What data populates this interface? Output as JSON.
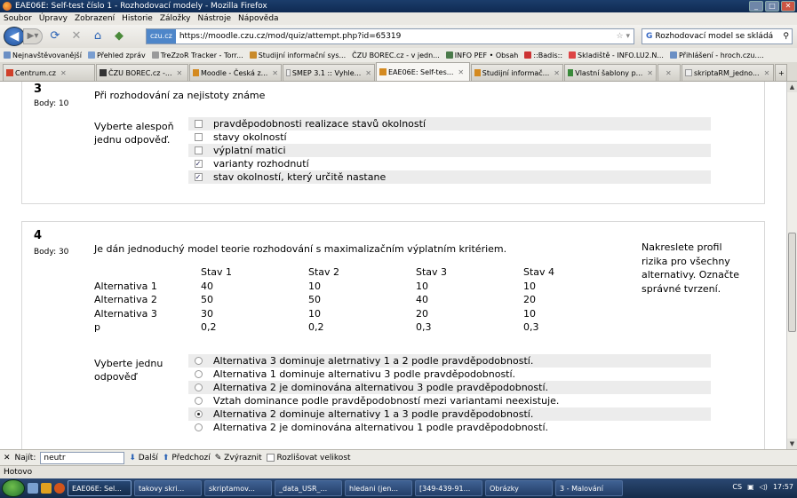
{
  "window": {
    "title": "EAE06E: Self-test číslo 1 - Rozhodovací modely - Mozilla Firefox"
  },
  "menu": [
    "Soubor",
    "Úpravy",
    "Zobrazení",
    "Historie",
    "Záložky",
    "Nástroje",
    "Nápověda"
  ],
  "nav": {
    "site_badge": "czu.cz",
    "url": "https://moodle.czu.cz/mod/quiz/attempt.php?id=65319",
    "search_value": "Rozhodovací model se skládá"
  },
  "bookmarks": [
    "Nejnavštěvovanější",
    "Přehled zpráv",
    "TreZzoR Tracker - Torr...",
    "Studijní informační sys...",
    "ČZU BOREC.cz - v jedn...",
    "INFO PEF • Obsah",
    "::Badis::",
    "Skladiště - INFO.LU2.N...",
    "Přihlášení - hroch.czu...."
  ],
  "tabs": [
    {
      "label": "Centrum.cz",
      "active": false
    },
    {
      "label": "ČZU BOREC.cz -...",
      "active": false
    },
    {
      "label": "Moodle - Česká z...",
      "active": false
    },
    {
      "label": "SMEP 3.1 :: Vyhle...",
      "active": false
    },
    {
      "label": "EAE06E: Self-tes...",
      "active": true
    },
    {
      "label": "Studijní informač...",
      "active": false
    },
    {
      "label": "Vlastní šablony p...",
      "active": false
    },
    {
      "label": "",
      "active": false
    },
    {
      "label": "skriptaRM_jedno...",
      "active": false
    }
  ],
  "q3": {
    "number": "3",
    "points": "Body: 10",
    "text": "Při rozhodování za nejistoty známe",
    "choose": "Vyberte alespoň jednu odpověď.",
    "options": [
      {
        "label": "pravděpodobnosti realizace stavů okolností",
        "checked": false
      },
      {
        "label": "stavy okolností",
        "checked": false
      },
      {
        "label": "výplatní matici",
        "checked": false
      },
      {
        "label": "varianty rozhodnutí",
        "checked": true
      },
      {
        "label": "stav okolností, který určitě nastane",
        "checked": true
      }
    ]
  },
  "q4": {
    "number": "4",
    "points": "Body: 30",
    "text": "Je dán jednoduchý model teorie rozhodování s maximalizačním výplatním kritériem.",
    "note": "Nakreslete profil rizika pro všechny alternativy. Označte správné tvrzení.",
    "table": {
      "headers": [
        "",
        "Stav 1",
        "Stav 2",
        "Stav 3",
        "Stav 4"
      ],
      "rows": [
        [
          "Alternativa 1",
          "40",
          "10",
          "10",
          "10"
        ],
        [
          "Alternativa 2",
          "50",
          "50",
          "40",
          "20"
        ],
        [
          "Alternativa 3",
          "30",
          "10",
          "20",
          "10"
        ],
        [
          "p",
          "0,2",
          "0,2",
          "0,3",
          "0,3"
        ]
      ]
    },
    "choose": "Vyberte jednu odpověď",
    "options": [
      {
        "label": "Alternativa 3 dominuje aletrnativy 1 a 2 podle pravděpodobností.",
        "selected": false
      },
      {
        "label": "Alternativa 1 dominuje alternativu 3 podle pravděpodobností.",
        "selected": false
      },
      {
        "label": "Alternativa 2 je dominována alternativou 3 podle pravděpodobností.",
        "selected": false
      },
      {
        "label": "Vztah dominance podle pravděpodobností mezi variantami neexistuje.",
        "selected": false
      },
      {
        "label": "Alternativa 2 dominuje alternativy 1 a 3 podle pravděpodobností.",
        "selected": true
      },
      {
        "label": "Alternativa 2 je dominována alternativou 1 podle pravděpodobností.",
        "selected": false
      }
    ]
  },
  "findbar": {
    "close": "✕",
    "label": "Najít:",
    "value": "neutr",
    "next": "Další",
    "prev": "Předchozí",
    "highlight": "Zvýraznit",
    "case": "Rozlišovat velikost"
  },
  "status": "Hotovo",
  "taskbar": {
    "tasks": [
      "EAE06E: Sel...",
      "takovy skri...",
      "skriptamov...",
      "_data_USR_...",
      "hledani (jen...",
      "[349-439-91...",
      "Obrázky",
      "3 - Malování"
    ],
    "lang": "CS",
    "time": "17:57"
  }
}
